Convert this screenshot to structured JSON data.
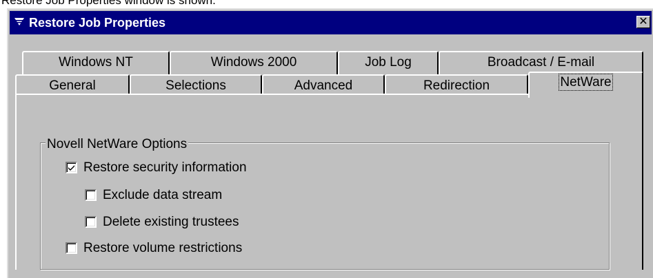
{
  "caption": "Restore Job Properties window is shown.",
  "window": {
    "title": "Restore Job Properties",
    "close_glyph": "✕",
    "icon": "menu-icon"
  },
  "tabs": {
    "back_row": [
      "Windows NT",
      "Windows 2000",
      "Job Log",
      "Broadcast / E-mail"
    ],
    "front_row": [
      "General",
      "Selections",
      "Advanced",
      "Redirection",
      "NetWare"
    ],
    "active": "NetWare"
  },
  "group": {
    "title": "Novell NetWare Options",
    "options": [
      {
        "label": "Restore security information",
        "checked": true
      },
      {
        "label": "Exclude data stream",
        "checked": false
      },
      {
        "label": "Delete existing trustees",
        "checked": false
      },
      {
        "label": "Restore volume restrictions",
        "checked": false
      }
    ]
  },
  "colors": {
    "titlebar": "#000080",
    "face": "#c0c0c0",
    "highlight": "#ffffff",
    "shadow": "#808080"
  }
}
